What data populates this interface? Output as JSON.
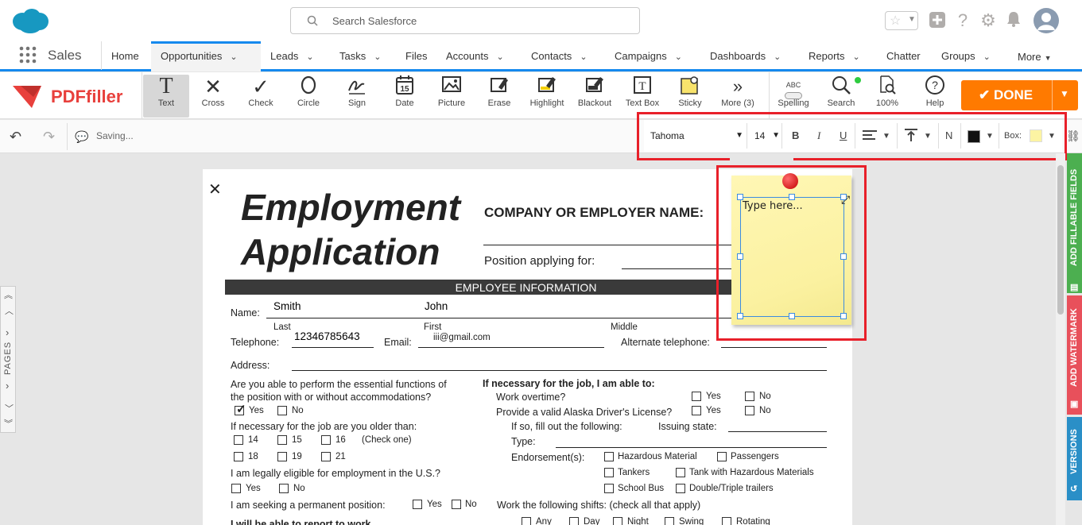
{
  "salesforce": {
    "search_placeholder": "Search Salesforce",
    "app_name": "Sales",
    "nav": [
      {
        "label": "Home",
        "chevron": false
      },
      {
        "label": "Opportunities",
        "chevron": true
      },
      {
        "label": "Leads",
        "chevron": true
      },
      {
        "label": "Tasks",
        "chevron": true
      },
      {
        "label": "Files",
        "chevron": false
      },
      {
        "label": "Accounts",
        "chevron": true
      },
      {
        "label": "Contacts",
        "chevron": true
      },
      {
        "label": "Campaigns",
        "chevron": true
      },
      {
        "label": "Dashboards",
        "chevron": true
      },
      {
        "label": "Reports",
        "chevron": true
      },
      {
        "label": "Chatter",
        "chevron": false
      },
      {
        "label": "Groups",
        "chevron": true
      },
      {
        "label": "More",
        "chevron": true
      }
    ],
    "active_nav": "Opportunities"
  },
  "pdffiller": {
    "logo_text": "PDFfiller",
    "tools": [
      "Text",
      "Cross",
      "Check",
      "Circle",
      "Sign",
      "Date",
      "Picture",
      "Erase",
      "Highlight",
      "Blackout",
      "Text Box",
      "Sticky",
      "More (3)"
    ],
    "right_tools": [
      "Spelling",
      "Search",
      "100%",
      "Help"
    ],
    "spelling_badge": "ABC",
    "done_label": "DONE",
    "saving_text": "Saving...",
    "date_icon_num": "15"
  },
  "format_bar": {
    "font": "Tahoma",
    "size": "14",
    "bold": "B",
    "italic": "I",
    "underline": "U",
    "n_label": "N",
    "box_label": "Box:",
    "box_color": "#fcf4a3",
    "text_color": "#111111"
  },
  "side_panel": {
    "pages_label": "PAGES",
    "tabs": [
      "ADD FILLABLE FIELDS",
      "ADD WATERMARK",
      "VERSIONS"
    ]
  },
  "document": {
    "title_line1": "Employment",
    "title_line2": "Application",
    "company_label": "COMPANY OR EMPLOYER NAME:",
    "position_label": "Position applying for:",
    "section_header": "EMPLOYEE INFORMATION",
    "name_label": "Name:",
    "last_value": "Smith",
    "first_value": "John",
    "last_label": "Last",
    "first_label": "First",
    "middle_label": "Middle",
    "telephone_label": "Telephone:",
    "telephone_value": "12346785643",
    "email_label": "Email:",
    "email_value": "iii@gmail.com",
    "alt_phone_label": "Alternate telephone:",
    "address_label": "Address:",
    "q_essential_1": "Are you able to perform the essential functions of",
    "q_essential_2": "the position with or without accommodations?",
    "yes": "Yes",
    "no": "No",
    "q_age": "If necessary for the job are you older than:",
    "ages_row1": [
      "14",
      "15",
      "16"
    ],
    "check_one": "(Check one)",
    "ages_row2": [
      "18",
      "19",
      "21"
    ],
    "q_eligible": "I am legally eligible for employment in the U.S.?",
    "q_permanent": "I am seeking a permanent position:",
    "q_report": "I will be able to report to work",
    "right_header": "If necessary for the job, I am able to:",
    "q_overtime": "Work overtime?",
    "q_license": "Provide a valid Alaska Driver's License?",
    "q_fill": "If so, fill out the following:",
    "issuing_state": "Issuing state:",
    "type_label": "Type:",
    "endorsements_label": "Endorsement(s):",
    "endorsements": [
      "Hazardous Material",
      "Passengers",
      "Tankers",
      "Tank with Hazardous Materials",
      "School Bus",
      "Double/Triple trailers"
    ],
    "q_shifts": "Work the following shifts: (check all that apply)",
    "shifts": [
      "Any",
      "Day",
      "Night",
      "Swing",
      "Rotating"
    ]
  },
  "sticky_note": {
    "placeholder": "Type here..."
  },
  "colors": {
    "salesforce_blue": "#1589ee",
    "done_orange": "#ff7a00",
    "highlight_red": "#e8202a",
    "tab_green": "#4caf50",
    "tab_red": "#e8505b",
    "tab_blue": "#2a8fc7"
  }
}
